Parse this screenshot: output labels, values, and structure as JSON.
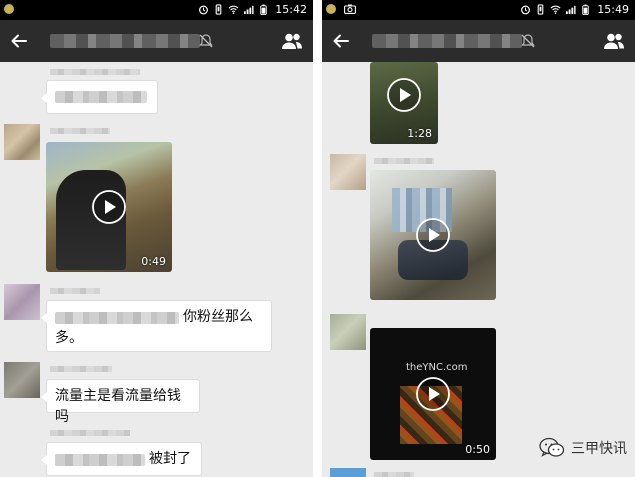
{
  "left": {
    "status": {
      "time": "15:42"
    },
    "messages": [
      {
        "text_suffix": "你粉丝那么多。"
      },
      {
        "text": "流量主是看流量给钱吗"
      },
      {
        "text_suffix": "被封了"
      }
    ],
    "video": {
      "duration": "0:49"
    }
  },
  "right": {
    "status": {
      "time": "15:49"
    },
    "videos": [
      {
        "duration": "1:28"
      },
      {
        "duration": ""
      },
      {
        "duration": "0:50",
        "watermark": "theYNC.com"
      }
    ]
  },
  "watermark": {
    "text": "三甲快讯",
    "icon": "wechat-icon"
  },
  "colors": {
    "titlebar": "#2c2c2c",
    "chat_bg": "#ebebeb",
    "bubble": "#ffffff"
  }
}
